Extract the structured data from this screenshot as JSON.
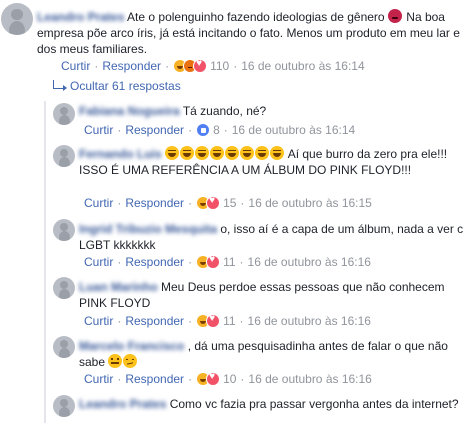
{
  "top_comment": {
    "author": "Leandro Prates",
    "text_a": "Ate o polenguinho fazendo ideologias de gênero",
    "text_b": "Na boa empresa põe arco íris, já está incitando o fato. Menos um produto em meu lar e dos meus familiares.",
    "emoji": "devil-icon",
    "reaction_count": "110",
    "timestamp": "16 de outubro às 16:14"
  },
  "labels": {
    "like": "Curtir",
    "reply": "Responder",
    "sep": "·",
    "hide_replies": "Ocultar 61 respostas"
  },
  "replies": [
    {
      "author": "Fabiana Nogueira",
      "text": "Tá zuando, né?",
      "reaction_count": "8",
      "timestamp": "16 de outubro às 16:14"
    },
    {
      "author": "Fernando Luis",
      "text_after": "Aí que burro da zero pra ele!!! ISSO É UMA REFERÊNCIA A UM ÁLBUM DO PINK FLOYD!!!",
      "laugh_emoji_count": 8,
      "reaction_count": "15",
      "timestamp": "16 de outubro às 16:15"
    },
    {
      "author": "Ingrid Tribuzio Mesquita",
      "text": "o, isso aí é a capa de um álbum, nada a ver c LGBT kkkkkkk",
      "reaction_count": "11",
      "timestamp": "16 de outubro às 16:16"
    },
    {
      "author": "Luan Marinho",
      "text": "Meu Deus perdoe essas pessoas que não conhecem PINK FLOYD",
      "reaction_count": "11",
      "timestamp": "16 de outubro às 16:16"
    },
    {
      "author": "Marcelo Francisco",
      "text": ", dá uma pesquisadinha antes de falar o que não sabe",
      "reaction_count": "10",
      "timestamp": "16 de outubro às 16:16"
    },
    {
      "author": "Leandro Prates",
      "text": "Como vc fazia pra passar vergonha antes da internet?"
    }
  ],
  "colors": {
    "link": "#4267b2",
    "name": "#385898",
    "meta": "#90949c",
    "text": "#1d2129"
  }
}
